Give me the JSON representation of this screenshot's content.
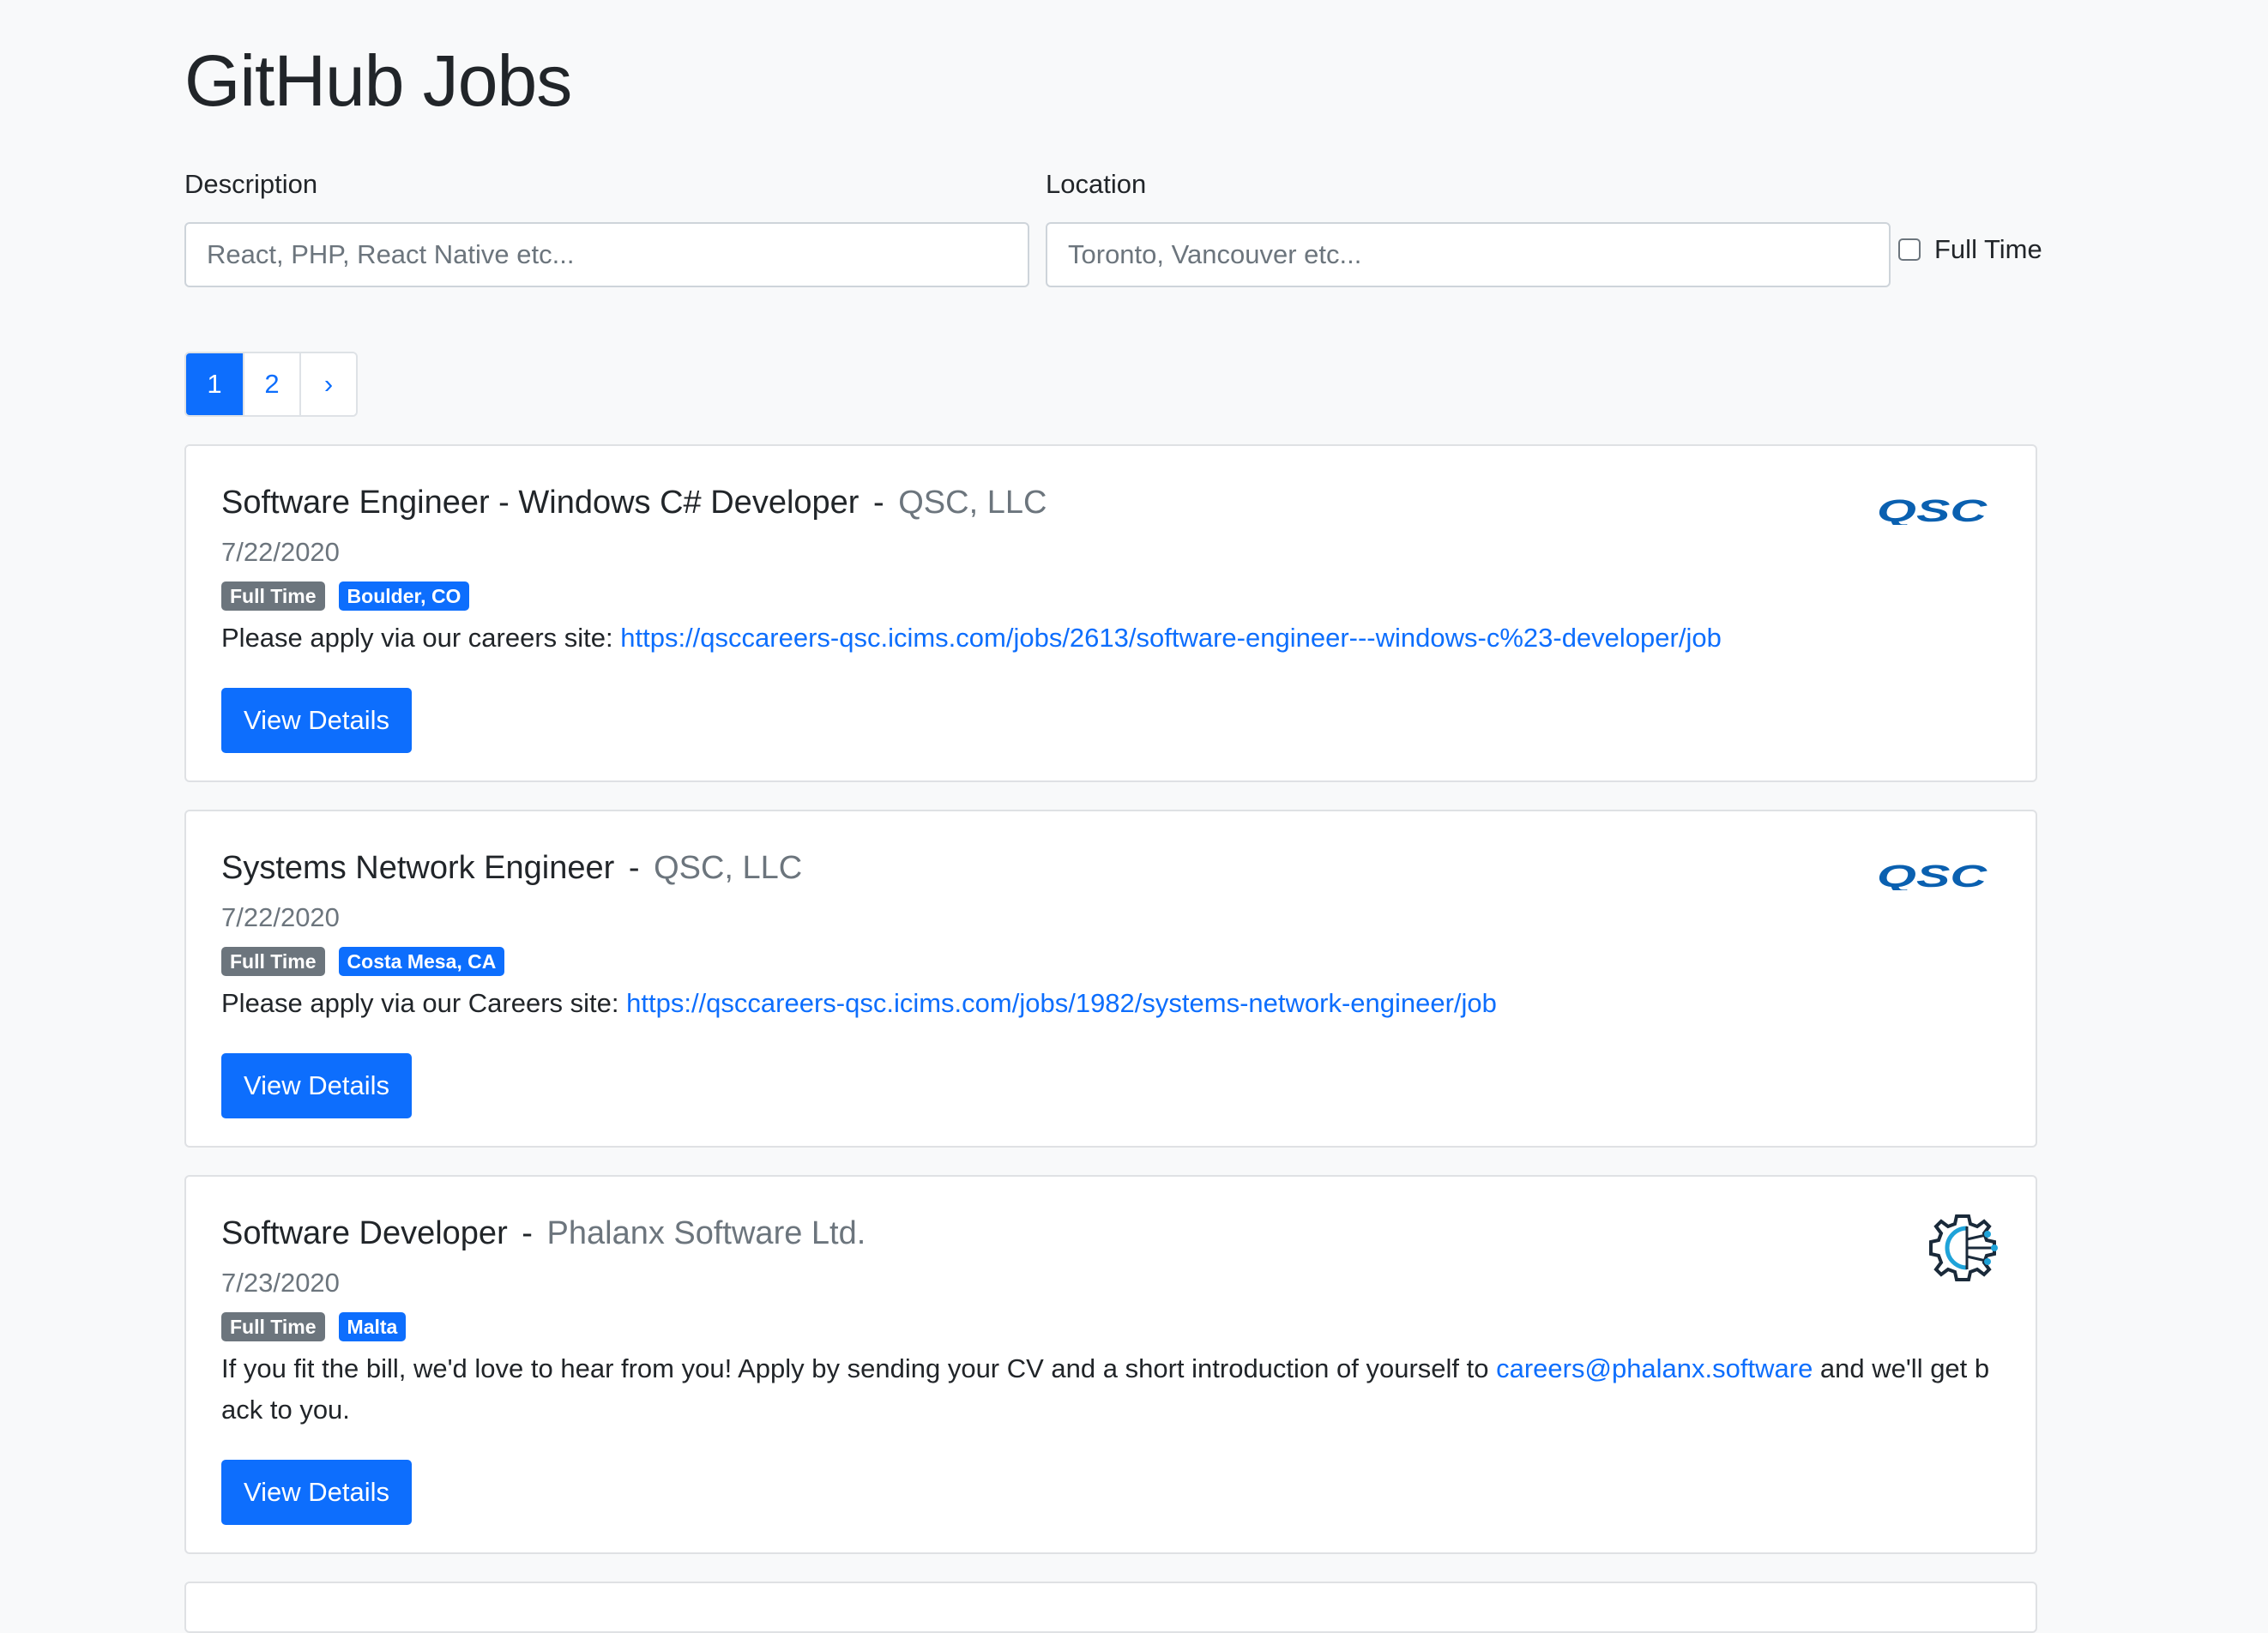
{
  "page": {
    "title": "GitHub Jobs"
  },
  "search": {
    "description_label": "Description",
    "description_placeholder": "React, PHP, React Native etc...",
    "location_label": "Location",
    "location_placeholder": "Toronto, Vancouver etc...",
    "full_time_label": "Full Time",
    "full_time_checked": false
  },
  "pagination": {
    "pages": [
      "1",
      "2"
    ],
    "current": "1",
    "next": "›"
  },
  "colors": {
    "primary": "#0d6efd",
    "secondary": "#6c757d",
    "qsc_logo": "#0a60b0"
  },
  "jobs": [
    {
      "title": "Software Engineer - Windows C# Developer",
      "separator": "-",
      "company": "QSC, LLC",
      "date": "7/22/2020",
      "type": "Full Time",
      "location": "Boulder, CO",
      "desc_text": "Please apply via our careers site: ",
      "desc_link": "https://qsccareers-qsc.icims.com/jobs/2613/software-engineer---windows-c%23-developer/job",
      "desc_after": "",
      "button": "View Details",
      "logo": "QSC"
    },
    {
      "title": "Systems Network Engineer",
      "separator": "-",
      "company": "QSC, LLC",
      "date": "7/22/2020",
      "type": "Full Time",
      "location": "Costa Mesa, CA",
      "desc_text": "Please apply via our Careers site: ",
      "desc_link": "https://qsccareers-qsc.icims.com/jobs/1982/systems-network-engineer/job",
      "desc_after": "",
      "button": "View Details",
      "logo": "QSC"
    },
    {
      "title": "Software Developer",
      "separator": "-",
      "company": "Phalanx Software Ltd.",
      "date": "7/23/2020",
      "type": "Full Time",
      "location": "Malta",
      "desc_text": "If you fit the bill, we'd love to hear from you! Apply by sending your CV and a short introduction of yourself to ",
      "desc_link": "careers@phalanx.software",
      "desc_after": " and we'll get back to you.",
      "button": "View Details",
      "logo": "phalanx-gear-icon"
    }
  ]
}
